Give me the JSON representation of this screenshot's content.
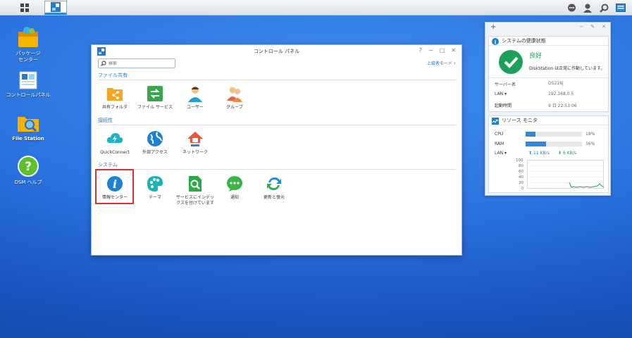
{
  "colors": {
    "accent": "#2876cc",
    "ok": "#1fa05a",
    "selection": "#e03030"
  },
  "taskbar": {
    "left_icons": [
      "main-menu-icon",
      "control-panel-app-icon"
    ],
    "right_icons": [
      "chat-icon",
      "user-icon",
      "search-icon",
      "widgets-icon"
    ]
  },
  "desktop": {
    "icons": [
      {
        "label": "パッケージ\nセンター",
        "icon": "package-center-icon"
      },
      {
        "label": "コントロールパネル",
        "icon": "control-panel-icon"
      },
      {
        "label": "File Station",
        "icon": "file-station-icon"
      },
      {
        "label": "DSM ヘルプ",
        "icon": "dsm-help-icon"
      }
    ]
  },
  "control_panel": {
    "title": "コントロール パネル",
    "search_placeholder": "検索",
    "advanced_mode": "上級者モード",
    "sections": [
      {
        "title": "ファイル共有",
        "items": [
          "共有フォルダ",
          "ファイル サービス",
          "ユーザー",
          "グループ"
        ]
      },
      {
        "title": "接続性",
        "items": [
          "QuickConnect",
          "外部アクセス",
          "ネットワーク"
        ]
      },
      {
        "title": "システム",
        "items": [
          "情報センター",
          "テーマ",
          "サービスにインデッ\nクスを付けています",
          "通知",
          "更新と復元"
        ]
      }
    ]
  },
  "widget": {
    "health": {
      "title": "システムの健康状態",
      "status": "良好",
      "message": "DiskStation は正常に作動しています。",
      "rows": [
        {
          "key": "サーバー名",
          "value": "DS216j"
        },
        {
          "key": "LAN ▾",
          "value": "192.168.0.5"
        },
        {
          "key": "起動時間",
          "value": "9 日 22:53:06"
        }
      ]
    },
    "resource": {
      "title": "リソース モニタ",
      "cpu_label": "CPU",
      "cpu_value": "18%",
      "cpu_pct": 18,
      "ram_label": "RAM",
      "ram_value": "36%",
      "ram_pct": 36,
      "lan_label": "LAN ▾",
      "up": "11 KB/s",
      "down": "6 KB/s",
      "y_ticks": [
        "100",
        "80",
        "60",
        "40",
        "20",
        "0"
      ]
    }
  }
}
